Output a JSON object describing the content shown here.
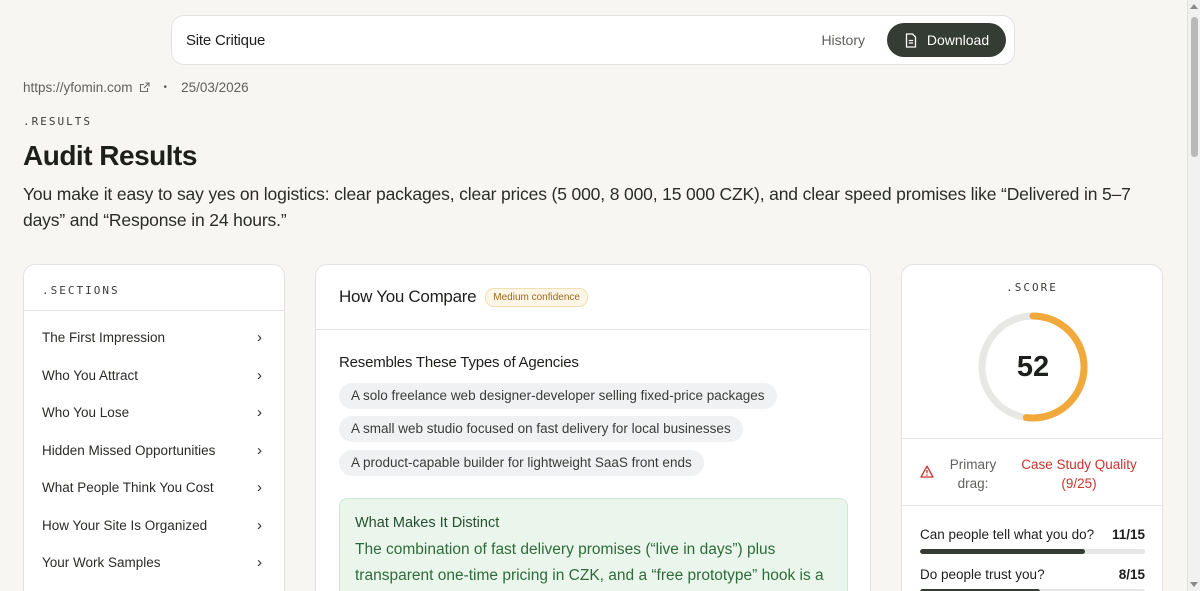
{
  "header": {
    "title": "Site Critique",
    "history_label": "History",
    "download_label": "Download",
    "download_icon": "document-icon"
  },
  "meta": {
    "url": "https://yfomin.com",
    "url_icon": "external-link-icon",
    "separator": "•",
    "date": "25/03/2026"
  },
  "results": {
    "eyebrow": ".RESULTS",
    "title": "Audit Results",
    "summary": "You make it easy to say yes on logistics: clear packages, clear prices (5 000, 8 000, 15 000 CZK), and clear speed promises like “Delivered in 5–7 days” and “Response in 24 hours.”"
  },
  "sections": {
    "eyebrow": ".SECTIONS",
    "items": [
      {
        "label": "The First Impression"
      },
      {
        "label": "Who You Attract"
      },
      {
        "label": "Who You Lose"
      },
      {
        "label": "Hidden Missed Opportunities"
      },
      {
        "label": "What People Think You Cost"
      },
      {
        "label": "How Your Site Is Organized"
      },
      {
        "label": "Your Work Samples"
      }
    ]
  },
  "compare": {
    "title": "How You Compare",
    "confidence": "Medium confidence",
    "resembles_title": "Resembles These Types of Agencies",
    "types": [
      "A solo freelance web designer-developer selling fixed-price packages",
      "A small web studio focused on fast delivery for local businesses",
      "A product-capable builder for lightweight SaaS front ends"
    ],
    "distinct_title": "What Makes It Distinct",
    "distinct_text": "The combination of fast delivery promises (“live in days”) plus transparent one-time pricing in CZK, and a “free prototype” hook is a"
  },
  "score": {
    "eyebrow": ".SCORE",
    "value": 52,
    "max": 100,
    "ring_color": "#f2a93b",
    "primary_drag_label": "Primary drag:",
    "primary_drag_value": "Case Study Quality (9/25)",
    "warn_icon": "warning-triangle-icon",
    "metrics": [
      {
        "label": "Can people tell what you do?",
        "score": "11/15",
        "fraction": 0.7333
      },
      {
        "label": "Do people trust you?",
        "score": "8/15",
        "fraction": 0.5333
      }
    ]
  },
  "colors": {
    "accent_dark": "#353c33",
    "warning_red": "#c8332b",
    "confidence_amber": "#9a6a1e",
    "distinct_green": "#2f6b3a"
  }
}
